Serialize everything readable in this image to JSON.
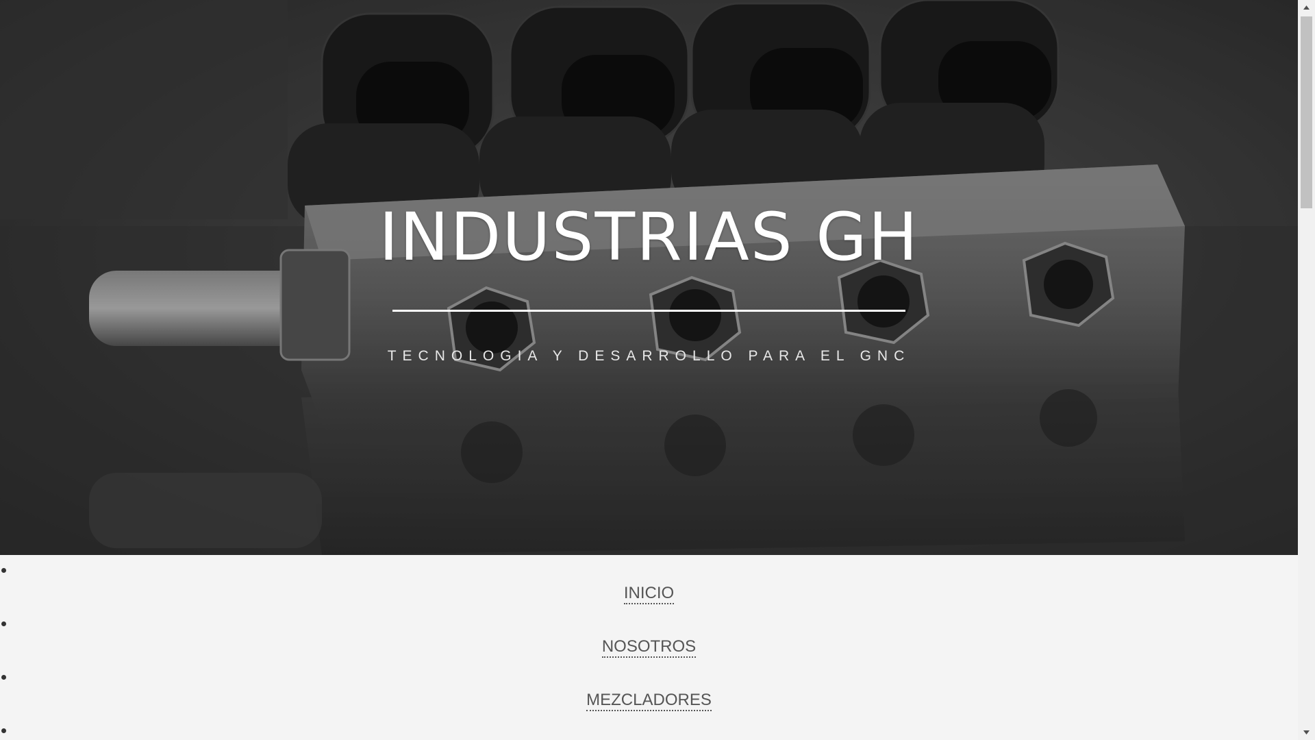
{
  "hero": {
    "title": "INDUSTRIAS GH",
    "subtitle": "TECNOLOGIA Y DESARROLLO PARA EL GNC",
    "background_image": "grayscale-gas-injector-rail-photo"
  },
  "nav": {
    "items": [
      {
        "label": "INICIO"
      },
      {
        "label": "NOSOTROS"
      },
      {
        "label": "MEZCLADORES"
      },
      {
        "label": ""
      }
    ]
  },
  "colors": {
    "page_background": "#f4f4f4",
    "link_color": "#555555",
    "hero_text": "#ffffff"
  },
  "icons": {
    "scroll_up": "triangle-up-icon",
    "scroll_down": "triangle-down-icon"
  }
}
